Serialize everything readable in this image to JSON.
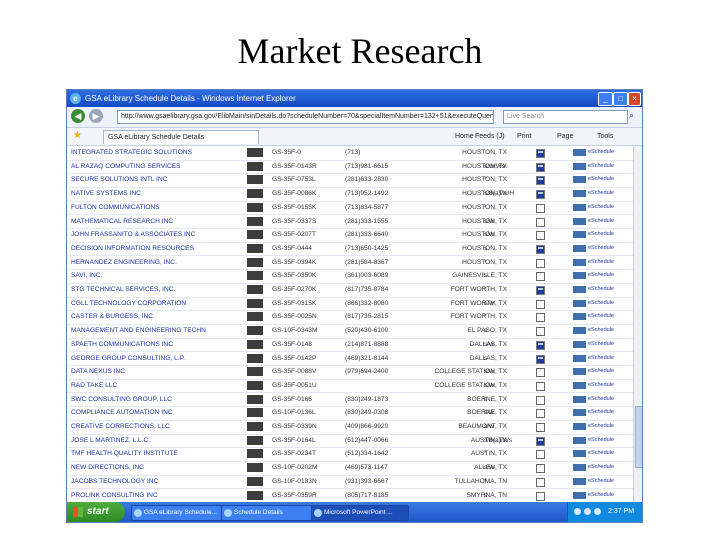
{
  "slide": {
    "title": "Market Research"
  },
  "window": {
    "title": "GSA eLibrary Schedule Details - Windows Internet Explorer",
    "address": "http://www.gsaelibrary.gsa.gov/ElibMain/sinDetails.do?scheduleNumber=70&specialItemNumber=132+51&executeQuery=YES",
    "search_placeholder": "Live Search",
    "tab_label": "GSA eLibrary Schedule Details",
    "toolbar": {
      "home": "Home",
      "feeds": "Feeds (J)",
      "print": "Print",
      "page": "Page",
      "tools": "Tools"
    }
  },
  "rows": [
    {
      "name": "INTEGRATED STRATEGIC SOLUTIONS",
      "contract": "GS-35F-0",
      "phone": "(713)",
      "city": "HOUSTON, TX",
      "code": "",
      "box": "icon",
      "link": "eSchedule"
    },
    {
      "name": "AL RAZAQ COMPUTING SERVICES",
      "contract": "GS-35F-0143R",
      "phone": "(713)981-6615",
      "city": "HOUSTON, TX",
      "code": "s/w/Ws",
      "box": "icon",
      "link": "eSchedule"
    },
    {
      "name": "SECURE SOLUTIONS INTL INC",
      "contract": "GS-35F-0753L",
      "phone": "(281)633-2830",
      "city": "HOUSTON, TX",
      "code": "*",
      "box": "icon",
      "link": "eSchedule"
    },
    {
      "name": "NATIVE SYSTEMS INC",
      "contract": "GS-35F-0086K",
      "phone": "(713)952-1492",
      "city": "HOUSTON, TX",
      "code": "s/8(a)/w/H",
      "box": "icon",
      "link": "eSchedule"
    },
    {
      "name": "FULTON COMMUNICATIONS",
      "contract": "GS-35F-0155K",
      "phone": "(713)834-5877",
      "city": "HOUSTON, TX",
      "code": "*",
      "box": "check",
      "link": "eSchedule"
    },
    {
      "name": "MATHEMATICAL RESEARCH INC",
      "contract": "GS-35F-0337S",
      "phone": "(281)333-1555",
      "city": "HOUSTON, TX",
      "code": "s/w",
      "box": "check",
      "link": "eSchedule"
    },
    {
      "name": "JOHN FRASSANITO & ASSOCIATES INC",
      "contract": "GS-35F-0207T",
      "phone": "(281)333-6640",
      "city": "HOUSTON, TX",
      "code": "s/w",
      "box": "check",
      "link": "eSchedule"
    },
    {
      "name": "DECISION INFORMATION RESOURCES",
      "contract": "GS-35F-0444",
      "phone": "(713)650-1425",
      "city": "HOUSTON, TX",
      "code": "s",
      "box": "icon",
      "link": "eSchedule"
    },
    {
      "name": "HERNANDEZ ENGINEERING, INC.",
      "contract": "GS-35F-0394K",
      "phone": "(281)584-8367",
      "city": "HOUSTON, TX",
      "code": "*",
      "box": "check",
      "link": "eSchedule"
    },
    {
      "name": "SAVI, INC.",
      "contract": "GS-35F-0350K",
      "phone": "(361)003-6089",
      "city": "GAINESVILLE, TX",
      "code": "s",
      "box": "check",
      "link": "eSchedule"
    },
    {
      "name": "STG TECHNICAL SERVICES, INC.",
      "contract": "GS-35F-0270K",
      "phone": "(817)735-8784",
      "city": "FORT WORTH, TX",
      "code": "*",
      "box": "icon",
      "link": "eSchedule"
    },
    {
      "name": "CGLL TECHNOLOGY CORPORATION",
      "contract": "GS-35F-0315K",
      "phone": "(866)332-8080",
      "city": "FORT WORTH, TX",
      "code": "s/w",
      "box": "check",
      "link": "eSchedule"
    },
    {
      "name": "CASTER & BURGESS, INC.",
      "contract": "GS-35F-0025N",
      "phone": "(817)735-2815",
      "city": "FORT WORTH, TX",
      "code": "*",
      "box": "check",
      "link": "eSchedule"
    },
    {
      "name": "MANAGEMENT AND ENGINEERING TECHN",
      "contract": "GS-10F-0343M",
      "phone": "(520)430-6100",
      "city": "EL PASO, TX",
      "code": "s",
      "box": "check",
      "link": "eSchedule"
    },
    {
      "name": "SPAETH COMMUNICATIONS INC",
      "contract": "GS-35F-0148",
      "phone": "(214)871-8888",
      "city": "DALLAS, TX",
      "code": "s/w",
      "box": "icon",
      "link": "eSchedule"
    },
    {
      "name": "GEORGE GROUP CONSULTING, L.P.",
      "contract": "GS-35F-0142P",
      "phone": "(469)321-8144",
      "city": "DALLAS, TX",
      "code": "s",
      "box": "icon",
      "link": "eSchedule"
    },
    {
      "name": "DATA NEXUS INC",
      "contract": "GS-35F-0088V",
      "phone": "(979)694-2400",
      "city": "COLLEGE STATION, TX",
      "code": "s/w",
      "box": "check",
      "link": "eSchedule"
    },
    {
      "name": "RAD TAKE LLC",
      "contract": "GS-35F-0051U",
      "phone": "",
      "city": "COLLEGE STATION, TX",
      "code": "s/w",
      "box": "check",
      "link": "eSchedule"
    },
    {
      "name": "SWC CONSULTING GROUP, LLC",
      "contract": "GS-35F-0166",
      "phone": "(830)249-1873",
      "city": "BOERNE, TX",
      "code": "s",
      "box": "check",
      "link": "eSchedule"
    },
    {
      "name": "COMPLIANCE AUTOMATION INC",
      "contract": "GS-10F-0136L",
      "phone": "(830)249-0308",
      "city": "BOERNE, TX",
      "code": "s/w",
      "box": "check",
      "link": "eSchedule"
    },
    {
      "name": "CREATIVE CORRECTIONS, LLC",
      "contract": "GS-35F-0339N",
      "phone": "(409)866-9920",
      "city": "BEAUMONT, TX",
      "code": "s/w",
      "box": "check",
      "link": "eSchedule"
    },
    {
      "name": "JOSE L MARTINEZ, L.L.C.",
      "contract": "GS-35F-0164L",
      "phone": "(512)447-0066",
      "city": "AUSTIN, TX",
      "code": "s/8(a)/Ws",
      "box": "icon",
      "link": "eSchedule"
    },
    {
      "name": "TMF HEALTH QUALITY INSTITUTE",
      "contract": "GS-35F-0234T",
      "phone": "(512)334-1642",
      "city": "AUSTIN, TX",
      "code": "*",
      "box": "check",
      "link": "eSchedule"
    },
    {
      "name": "NEW DIRECTIONS, INC",
      "contract": "GS-10F-0202M",
      "phone": "(469)573-1147",
      "city": "ALLEN, TX",
      "code": "s/w",
      "box": "check",
      "link": "eSchedule"
    },
    {
      "name": "JACOBS TECHNOLOGY INC",
      "contract": "GS-10F-0183N",
      "phone": "(931)393-6667",
      "city": "TULLAHOMA, TN",
      "code": "*",
      "box": "check",
      "link": "eSchedule"
    },
    {
      "name": "PROLINK CONSULTING INC",
      "contract": "GS-35F-0359R",
      "phone": "(805)717-8185",
      "city": "SMYRNA, TN",
      "code": "s",
      "box": "check",
      "link": "eSchedule"
    }
  ],
  "taskbar": {
    "start": "start",
    "items": [
      "GSA eLibrary Schedule...",
      "Schedule Details",
      "Microsoft PowerPoint ..."
    ],
    "clock": "2:37 PM"
  }
}
